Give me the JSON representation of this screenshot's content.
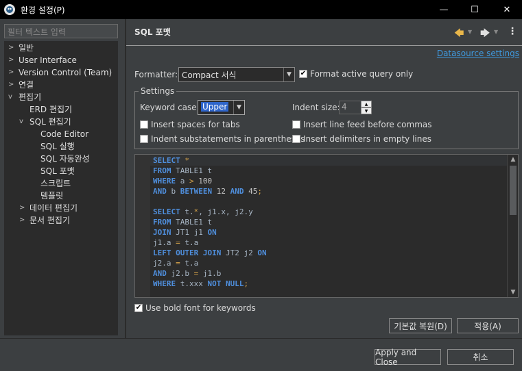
{
  "window": {
    "title": "환경 설정(P)",
    "minimize_glyph": "—",
    "maximize_glyph": "☐",
    "close_glyph": "✕"
  },
  "filter": {
    "placeholder": "필터 텍스트 입력"
  },
  "tree": [
    {
      "label": "일반",
      "twisty": ">"
    },
    {
      "label": "User Interface",
      "twisty": ">"
    },
    {
      "label": "Version Control (Team)",
      "twisty": ">"
    },
    {
      "label": "연결",
      "twisty": ">"
    },
    {
      "label": "편집기",
      "twisty": "v"
    },
    {
      "label": "ERD 편집기",
      "twisty": ""
    },
    {
      "label": "SQL 편집기",
      "twisty": "v"
    },
    {
      "label": "Code Editor",
      "twisty": ""
    },
    {
      "label": "SQL 실행",
      "twisty": ""
    },
    {
      "label": "SQL 자동완성",
      "twisty": ""
    },
    {
      "label": "SQL 포맷",
      "twisty": ""
    },
    {
      "label": "스크립트",
      "twisty": ""
    },
    {
      "label": "템플릿",
      "twisty": ""
    },
    {
      "label": "데이터 편집기",
      "twisty": ">"
    },
    {
      "label": "문서 편집기",
      "twisty": ">"
    }
  ],
  "page": {
    "title": "SQL 포맷",
    "datasource_link": "Datasource settings",
    "formatter_label": "Formatter:",
    "formatter_value": "Compact 서식",
    "format_active_label": "Format active query only",
    "settings_title": "Settings",
    "keyword_case_label": "Keyword case:",
    "keyword_case_value": "Upper",
    "indent_size_label": "Indent size:",
    "indent_size_value": "4",
    "insert_spaces_label": "Insert spaces for tabs",
    "insert_linefeed_label": "Insert line feed before commas",
    "indent_sub_label": "Indent substatements in parentheses",
    "insert_delims_label": "Insert delimiters in empty lines",
    "bold_font_label": "Use bold font for keywords",
    "restore_defaults": "기본값 복원(D)",
    "apply": "적용(A)"
  },
  "checkboxes": {
    "format_active": true,
    "insert_spaces": false,
    "insert_linefeed": false,
    "indent_sub": false,
    "insert_delims": false,
    "bold_font": true
  },
  "code_lines": [
    "SELECT *",
    "FROM TABLE1 t",
    "WHERE a > 100",
    "AND b BETWEEN 12 AND 45;",
    "",
    "SELECT t.*, j1.x, j2.y",
    "FROM TABLE1 t",
    "JOIN JT1 j1 ON",
    "j1.a = t.a",
    "LEFT OUTER JOIN JT2 j2 ON",
    "j2.a = t.a",
    "AND j2.b = j1.b",
    "WHERE t.xxx NOT NULL;"
  ],
  "footer": {
    "apply_close": "Apply and Close",
    "cancel": "취소"
  }
}
